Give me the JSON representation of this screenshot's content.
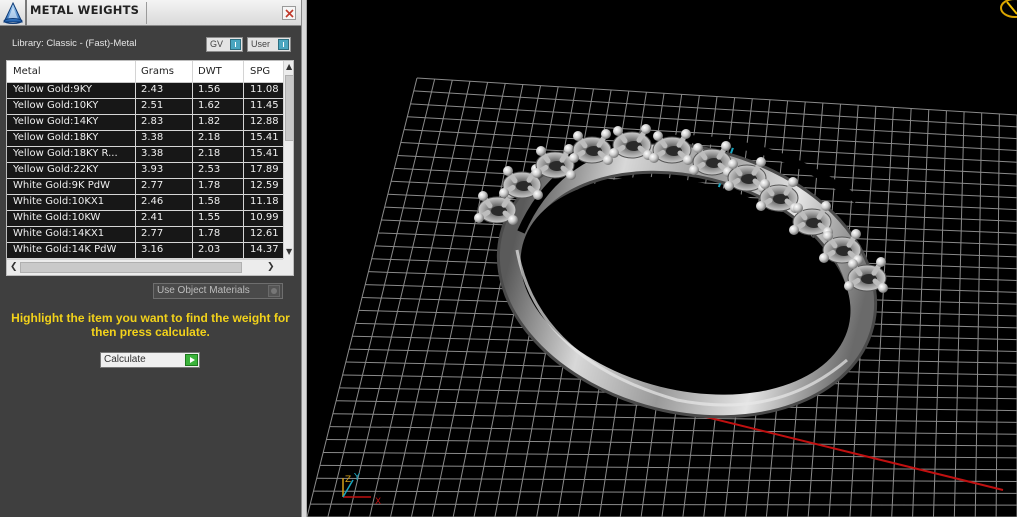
{
  "panel": {
    "title": "METAL WEIGHTS",
    "library_label": "Library: Classic - (Fast)-Metal",
    "toggle_gv": "GV",
    "toggle_user": "User",
    "columns": [
      "Metal",
      "Grams",
      "DWT",
      "SPG"
    ],
    "rows": [
      {
        "metal": "Yellow Gold:9KY",
        "grams": "2.43",
        "dwt": "1.56",
        "spg": "11.08"
      },
      {
        "metal": "Yellow Gold:10KY",
        "grams": "2.51",
        "dwt": "1.62",
        "spg": "11.45"
      },
      {
        "metal": "Yellow Gold:14KY",
        "grams": "2.83",
        "dwt": "1.82",
        "spg": "12.88"
      },
      {
        "metal": "Yellow Gold:18KY",
        "grams": "3.38",
        "dwt": "2.18",
        "spg": "15.41"
      },
      {
        "metal": "Yellow Gold:18KY R...",
        "grams": "3.38",
        "dwt": "2.18",
        "spg": "15.41"
      },
      {
        "metal": "Yellow Gold:22KY",
        "grams": "3.93",
        "dwt": "2.53",
        "spg": "17.89"
      },
      {
        "metal": "White Gold:9K PdW",
        "grams": "2.77",
        "dwt": "1.78",
        "spg": "12.59"
      },
      {
        "metal": "White Gold:10KX1",
        "grams": "2.46",
        "dwt": "1.58",
        "spg": "11.18"
      },
      {
        "metal": "White Gold:10KW",
        "grams": "2.41",
        "dwt": "1.55",
        "spg": "10.99"
      },
      {
        "metal": "White Gold:14KX1",
        "grams": "2.77",
        "dwt": "1.78",
        "spg": "12.61"
      },
      {
        "metal": "White Gold:14K PdW",
        "grams": "3.16",
        "dwt": "2.03",
        "spg": "14.37"
      }
    ],
    "use_object_materials": "Use Object Materials",
    "hint": "Highlight the item you want to find the weight for then press calculate.",
    "calculate_label": "Calculate"
  },
  "viewport": {
    "axis_labels": {
      "z": "Z",
      "y": "Y",
      "x": "X"
    },
    "colors": {
      "grid": "#8a8a8a",
      "x_axis": "#c01010",
      "y_axis": "#18a6c0",
      "hint": "#f2d21b"
    }
  }
}
